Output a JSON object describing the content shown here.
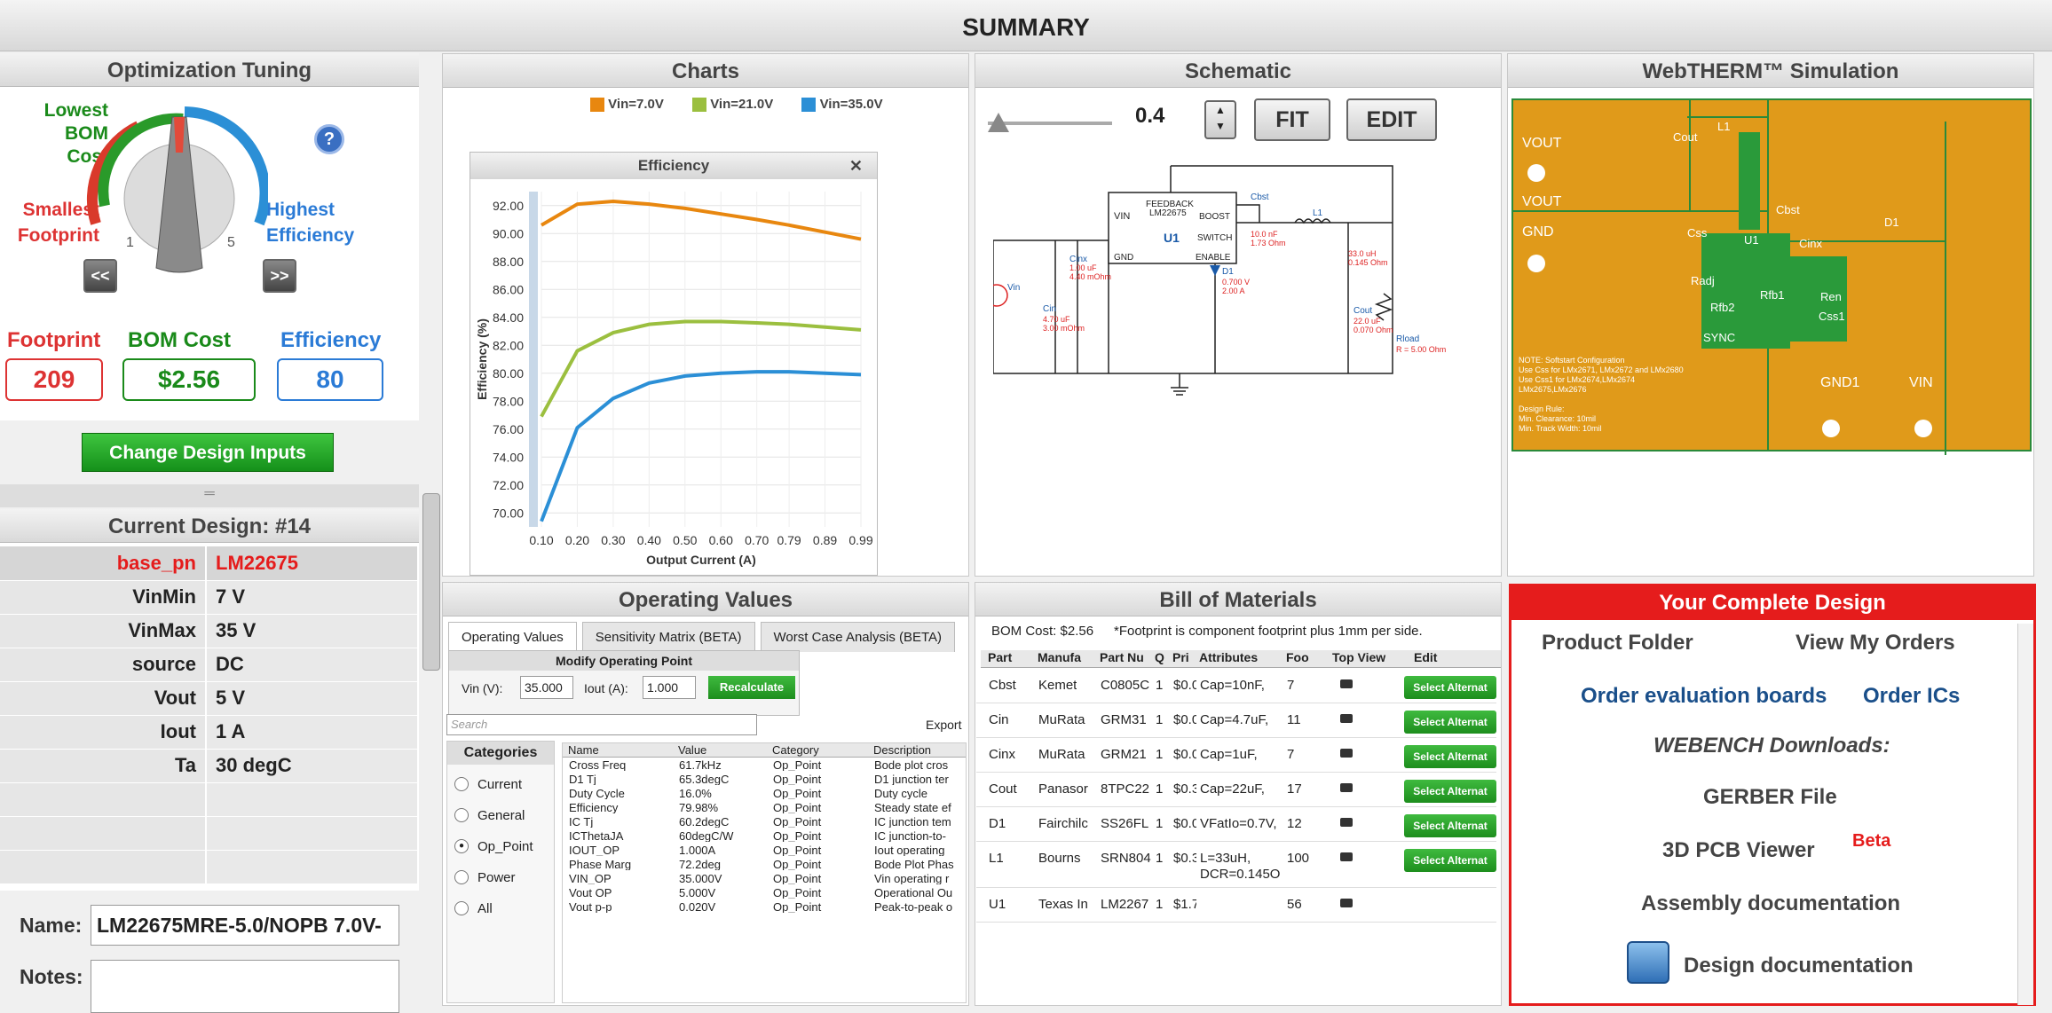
{
  "title": "SUMMARY",
  "optimization": {
    "header": "Optimization Tuning",
    "lowest_bom": "Lowest",
    "lowest_bom2": "BOM Cost",
    "smallest": "Smallest",
    "smallest2": "Footprint",
    "highest": "Highest",
    "highest2": "Efficiency",
    "scale_min": "1",
    "scale_max": "5",
    "prev": "<<",
    "next": ">>",
    "help": "?"
  },
  "metrics": {
    "footprint_label": "Footprint",
    "footprint": "209",
    "bom_label": "BOM Cost",
    "bom": "$2.56",
    "eff_label": "Efficiency",
    "eff": "80"
  },
  "change_inputs": "Change Design Inputs",
  "current_design": {
    "header": "Current Design: #14",
    "rows": [
      {
        "k": "base_pn",
        "v": "LM22675"
      },
      {
        "k": "VinMin",
        "v": "7 V"
      },
      {
        "k": "VinMax",
        "v": "35 V"
      },
      {
        "k": "source",
        "v": "DC"
      },
      {
        "k": "Vout",
        "v": "5 V"
      },
      {
        "k": "Iout",
        "v": "1 A"
      },
      {
        "k": "Ta",
        "v": "30 degC"
      }
    ]
  },
  "name_label": "Name:",
  "name_value": "LM22675MRE-5.0/NOPB 7.0V-",
  "notes_label": "Notes:",
  "charts": {
    "header": "Charts",
    "legend": [
      "Vin=7.0V",
      "Vin=21.0V",
      "Vin=35.0V"
    ],
    "popup_title": "Efficiency",
    "close": "✕"
  },
  "chart_data": {
    "type": "line",
    "title": "Efficiency",
    "xlabel": "Output Current (A)",
    "ylabel": "Efficiency (%)",
    "x": [
      0.1,
      0.2,
      0.3,
      0.4,
      0.5,
      0.6,
      0.7,
      0.79,
      0.89,
      0.99
    ],
    "xticks": [
      "0.10",
      "0.20",
      "0.30",
      "0.40",
      "0.50",
      "0.60",
      "0.70",
      "0.79",
      "0.89",
      "0.99"
    ],
    "yticks": [
      "92.00",
      "90.00",
      "88.00",
      "86.00",
      "84.00",
      "82.00",
      "80.00",
      "78.00",
      "76.00",
      "74.00",
      "72.00",
      "70.00"
    ],
    "ylim": [
      69,
      93
    ],
    "grid": true,
    "legend": "top",
    "series": [
      {
        "name": "Vin=7.0V",
        "color": "#e8870f",
        "values": [
          90.6,
          92.1,
          92.3,
          92.1,
          91.8,
          91.4,
          91.0,
          90.6,
          90.1,
          89.6
        ]
      },
      {
        "name": "Vin=21.0V",
        "color": "#9bbf3f",
        "values": [
          76.9,
          81.6,
          82.9,
          83.5,
          83.7,
          83.7,
          83.6,
          83.5,
          83.3,
          83.1
        ]
      },
      {
        "name": "Vin=35.0V",
        "color": "#2b8fd6",
        "values": [
          69.4,
          76.1,
          78.2,
          79.3,
          79.8,
          80.0,
          80.1,
          80.1,
          80.0,
          79.9
        ]
      }
    ]
  },
  "schematic": {
    "header": "Schematic",
    "zoom": "0.4",
    "fit": "FIT",
    "edit": "EDIT",
    "ic_label": "U1",
    "ic_part": "LM22675",
    "pins": [
      "VIN",
      "FEEDBACK",
      "BOOST",
      "SWITCH",
      "GND",
      "ENABLE"
    ],
    "labels": {
      "cbst": "Cbst",
      "cbst_v": "10.0 nF",
      "cbst_r": "1.73 Ohm",
      "l1": "L1",
      "l1_v": "33.0 uH",
      "l1_r": "0.145 Ohm",
      "d1": "D1",
      "d1_v": "0.700 V",
      "d1_a": "2.00 A",
      "cinx": "Cinx",
      "cinx_v": "1.00 uF",
      "cinx_r": "4.40 mOhm",
      "cin": "Cin",
      "cin_v": "4.70 uF",
      "cin_r": "3.00 mOhm",
      "cout": "Cout",
      "cout_v": "22.0 uF",
      "cout_r": "0.070 Ohm",
      "rload": "Rload",
      "rload_v": "R = 5.00 Ohm",
      "vin": "Vin"
    }
  },
  "webtherm": {
    "header": "WebTHERM™ Simulation",
    "labels": [
      "VOUT",
      "VOUT",
      "GND",
      "Cout",
      "L1",
      "Cbst",
      "D1",
      "Css",
      "U1",
      "Cinx",
      "Radj",
      "Rfb2",
      "Rfb1",
      "Ren",
      "Css1",
      "SYNC",
      "GND1",
      "VIN"
    ],
    "note": [
      "NOTE: Softstart Configuration",
      "Use Css for LMx2671, LMx2672 and LMx2680",
      "Use Css1 for LMx2674,LMx2674",
      "LMx2675,LMx2676",
      "",
      "Design Rule:",
      "Min. Clearance: 10mil",
      "Min. Track Width: 10mil"
    ]
  },
  "operating": {
    "header": "Operating Values",
    "tabs": [
      "Operating Values",
      "Sensitivity Matrix (BETA)",
      "Worst Case Analysis (BETA)"
    ],
    "modify": "Modify Operating Point",
    "vin_label": "Vin (V):",
    "vin": "35.000",
    "iout_label": "Iout (A):",
    "iout": "1.000",
    "recalc": "Recalculate",
    "search_placeholder": "Search",
    "export": "Export",
    "categories_label": "Categories",
    "categories": [
      "Current",
      "General",
      "Op_Point",
      "Power",
      "All"
    ],
    "columns": [
      "Name",
      "Value",
      "Category",
      "Description"
    ],
    "rows": [
      [
        "Cross Freq",
        "61.7kHz",
        "Op_Point",
        "Bode plot cros"
      ],
      [
        "D1 Tj",
        "65.3degC",
        "Op_Point",
        "D1 junction ter"
      ],
      [
        "Duty Cycle",
        "16.0%",
        "Op_Point",
        "Duty cycle"
      ],
      [
        "Efficiency",
        "79.98%",
        "Op_Point",
        "Steady state ef"
      ],
      [
        "IC Tj",
        "60.2degC",
        "Op_Point",
        "IC junction tem"
      ],
      [
        "ICThetaJA",
        "60degC/W",
        "Op_Point",
        "IC junction-to-"
      ],
      [
        "IOUT_OP",
        "1.000A",
        "Op_Point",
        "Iout operating"
      ],
      [
        "Phase Marg",
        "72.2deg",
        "Op_Point",
        "Bode Plot Phas"
      ],
      [
        "VIN_OP",
        "35.000V",
        "Op_Point",
        "Vin operating r"
      ],
      [
        "Vout OP",
        "5.000V",
        "Op_Point",
        "Operational Ou"
      ],
      [
        "Vout p-p",
        "0.020V",
        "Op_Point",
        "Peak-to-peak o"
      ]
    ]
  },
  "bom": {
    "header": "Bill of Materials",
    "cost": "BOM Cost: $2.56",
    "footnote": "*Footprint is component footprint plus 1mm per side.",
    "columns": [
      "Part",
      "Manufa",
      "Part Nu",
      "Q",
      "Pri",
      "Attributes",
      "Foo",
      "Top View",
      "Edit"
    ],
    "select": "Select Alternat",
    "rows": [
      {
        "part": "Cbst",
        "mfr": "Kemet",
        "pn": "C0805C",
        "q": "1",
        "price": "$0.0",
        "attr": "Cap=10nF,",
        "foot": "7"
      },
      {
        "part": "Cin",
        "mfr": "MuRata",
        "pn": "GRM31",
        "q": "1",
        "price": "$0.0",
        "attr": "Cap=4.7uF,",
        "foot": "11"
      },
      {
        "part": "Cinx",
        "mfr": "MuRata",
        "pn": "GRM21",
        "q": "1",
        "price": "$0.0",
        "attr": "Cap=1uF,",
        "foot": "7"
      },
      {
        "part": "Cout",
        "mfr": "Panasor",
        "pn": "8TPC22",
        "q": "1",
        "price": "$0.3",
        "attr": "Cap=22uF,",
        "foot": "17"
      },
      {
        "part": "D1",
        "mfr": "Fairchilc",
        "pn": "SS26FL",
        "q": "1",
        "price": "$0.0",
        "attr": "VFatIo=0.7V,",
        "foot": "12"
      },
      {
        "part": "L1",
        "mfr": "Bourns",
        "pn": "SRN804",
        "q": "1",
        "price": "$0.3",
        "attr": "L=33uH,",
        "attr2": "DCR=0.145O",
        "foot": "100"
      },
      {
        "part": "U1",
        "mfr": "Texas In",
        "pn": "LM2267",
        "q": "1",
        "price": "$1.7",
        "attr": "",
        "foot": "56"
      }
    ]
  },
  "complete": {
    "header": "Your Complete Design",
    "product_folder": "Product Folder",
    "view_orders": "View My Orders",
    "order_eval": "Order evaluation boards",
    "order_ics": "Order ICs",
    "downloads": "WEBENCH Downloads:",
    "gerber": "GERBER File",
    "pcb3d": "3D PCB Viewer",
    "beta": "Beta",
    "assembly": "Assembly documentation",
    "design_doc": "Design documentation"
  }
}
